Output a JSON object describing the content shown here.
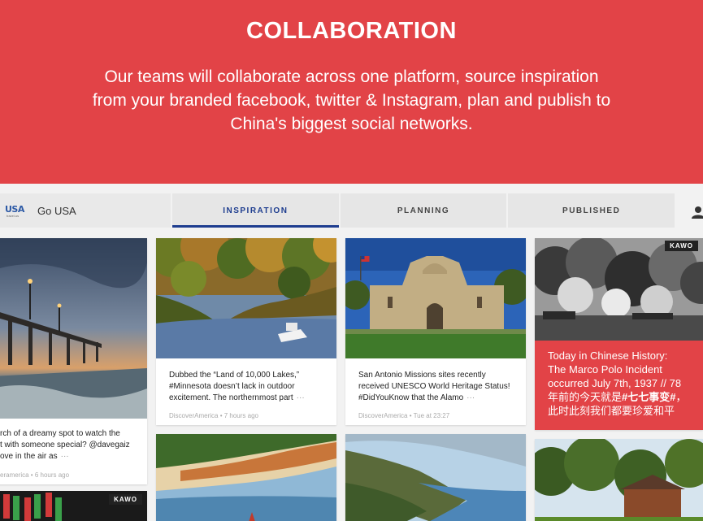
{
  "hero": {
    "title": "COLLABORATION",
    "body_line1": "Our teams will collaborate across one platform, source inspiration",
    "body_line2": "from your branded facebook, twitter & Instagram, plan and publish to",
    "body_line3": "China's biggest social networks."
  },
  "app": {
    "logo_text": "USA",
    "logo_sub": "travel.us",
    "brand_name": "Go USA",
    "tabs": [
      {
        "label": "INSPIRATION",
        "active": true
      },
      {
        "label": "PLANNING",
        "active": false
      },
      {
        "label": "PUBLISHED",
        "active": false
      }
    ]
  },
  "cards": {
    "pier": {
      "text_line1": "rch of a dreamy spot to watch the",
      "text_line2": "t with someone special? @davegaiz",
      "text_line3": "ove in the air as",
      "ellipsis": "···",
      "source": "eramerica",
      "time": "6 hours ago"
    },
    "minnesota": {
      "text_line1": "Dubbed the “Land of 10,000 Lakes,”",
      "text_line2": "#Minnesota doesn’t lack in outdoor",
      "text_line3": "excitement. The northernmost part",
      "ellipsis": "···",
      "source": "DiscoverAmerica",
      "time": "7 hours ago"
    },
    "alamo": {
      "text_line1": "San Antonio Missions sites recently",
      "text_line2": "received UNESCO World Heritage Status!",
      "text_line3": "#DidYouKnow that the Alamo",
      "ellipsis": "···",
      "source": "DiscoverAmerica",
      "time": "Tue at 23:27"
    },
    "history": {
      "badge": "KAWO",
      "line1": "Today in Chinese History:",
      "line2": "The Marco Polo Incident",
      "line3": "occurred July 7th, 1937 // 78",
      "line4_pre": "年前的今天就是",
      "line4_hash": "#七七事变#",
      "line4_post": "，",
      "line5": "此时此刻我们都要珍爱和平"
    },
    "bottom_left_badge": "KAWO"
  },
  "colors": {
    "brand_red": "#e24347",
    "tab_active": "#1e3d8f"
  }
}
